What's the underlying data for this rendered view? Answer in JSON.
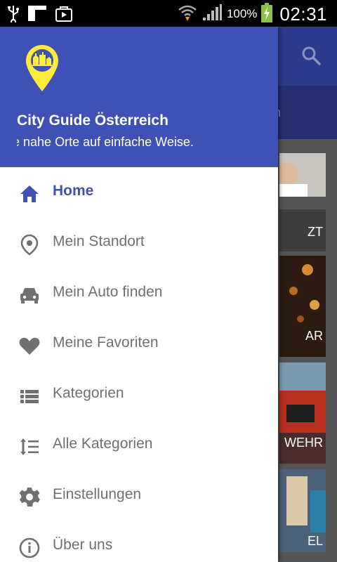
{
  "status_bar": {
    "battery_percent": "100%",
    "time": "02:31"
  },
  "app_behind": {
    "tab_text": "an",
    "tiles": [
      {
        "label": "ZT"
      },
      {
        "label": "AR"
      },
      {
        "label": "WEHR"
      },
      {
        "label": "EL"
      }
    ]
  },
  "drawer": {
    "title": "City Guide Österreich",
    "subtitle": "Finde nahe Orte auf einfache Weise.",
    "items": [
      {
        "label": "Home",
        "icon": "home-icon",
        "active": true
      },
      {
        "label": "Mein Standort",
        "icon": "location-icon",
        "active": false
      },
      {
        "label": "Mein Auto finden",
        "icon": "car-icon",
        "active": false
      },
      {
        "label": "Meine Favoriten",
        "icon": "heart-icon",
        "active": false
      },
      {
        "label": "Kategorien",
        "icon": "list-icon",
        "active": false
      },
      {
        "label": "Alle Kategorien",
        "icon": "sort-icon",
        "active": false
      },
      {
        "label": "Einstellungen",
        "icon": "gear-icon",
        "active": false
      },
      {
        "label": "Über uns",
        "icon": "info-icon",
        "active": false
      }
    ]
  },
  "colors": {
    "primary": "#3f51b5",
    "accent": "#ffeb3b",
    "menu_text": "#707070"
  }
}
